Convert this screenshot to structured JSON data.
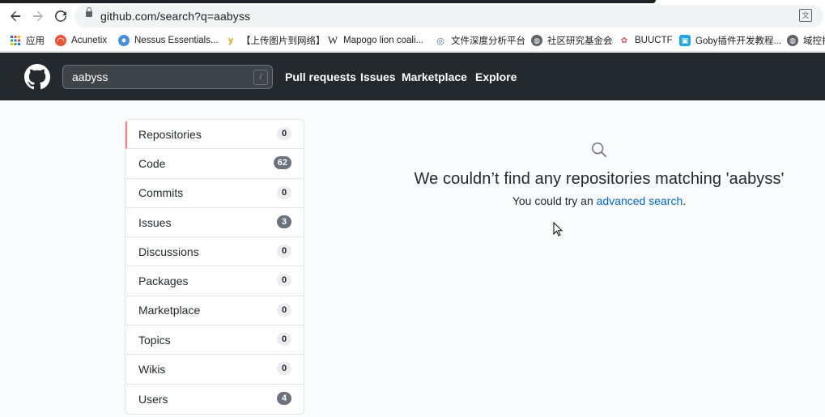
{
  "browser": {
    "url": "github.com/search?q=aabyss",
    "bookmarks": [
      {
        "label": "应用",
        "icon": "apps-grid-icon"
      },
      {
        "label": "Acunetix",
        "icon": "acunetix-icon"
      },
      {
        "label": "Nessus Essentials...",
        "icon": "nessus-icon"
      },
      {
        "label": "【上传图片到网络】",
        "icon": "upload-y-icon"
      },
      {
        "label": "Mapogo lion coali...",
        "icon": "wikipedia-icon"
      },
      {
        "label": "文件深度分析平台",
        "icon": "eye-icon"
      },
      {
        "label": "社区研究基金会",
        "icon": "globe-icon"
      },
      {
        "label": "BUUCTF",
        "icon": "buuctf-icon"
      },
      {
        "label": "Goby插件开发教程...",
        "icon": "goby-icon"
      },
      {
        "label": "域控排",
        "icon": "globe-icon"
      }
    ]
  },
  "header": {
    "search_value": "aabyss",
    "slash_hint": "/",
    "nav": [
      "Pull requests",
      "Issues",
      "Marketplace",
      "Explore"
    ]
  },
  "sidebar": {
    "items": [
      {
        "label": "Repositories",
        "count": "0"
      },
      {
        "label": "Code",
        "count": "62"
      },
      {
        "label": "Commits",
        "count": "0"
      },
      {
        "label": "Issues",
        "count": "3"
      },
      {
        "label": "Discussions",
        "count": "0"
      },
      {
        "label": "Packages",
        "count": "0"
      },
      {
        "label": "Marketplace",
        "count": "0"
      },
      {
        "label": "Topics",
        "count": "0"
      },
      {
        "label": "Wikis",
        "count": "0"
      },
      {
        "label": "Users",
        "count": "4"
      }
    ]
  },
  "results": {
    "heading": "We couldn’t find any repositories matching 'aabyss'",
    "hint_prefix": "You could try an ",
    "hint_link": "advanced search",
    "hint_suffix": "."
  }
}
